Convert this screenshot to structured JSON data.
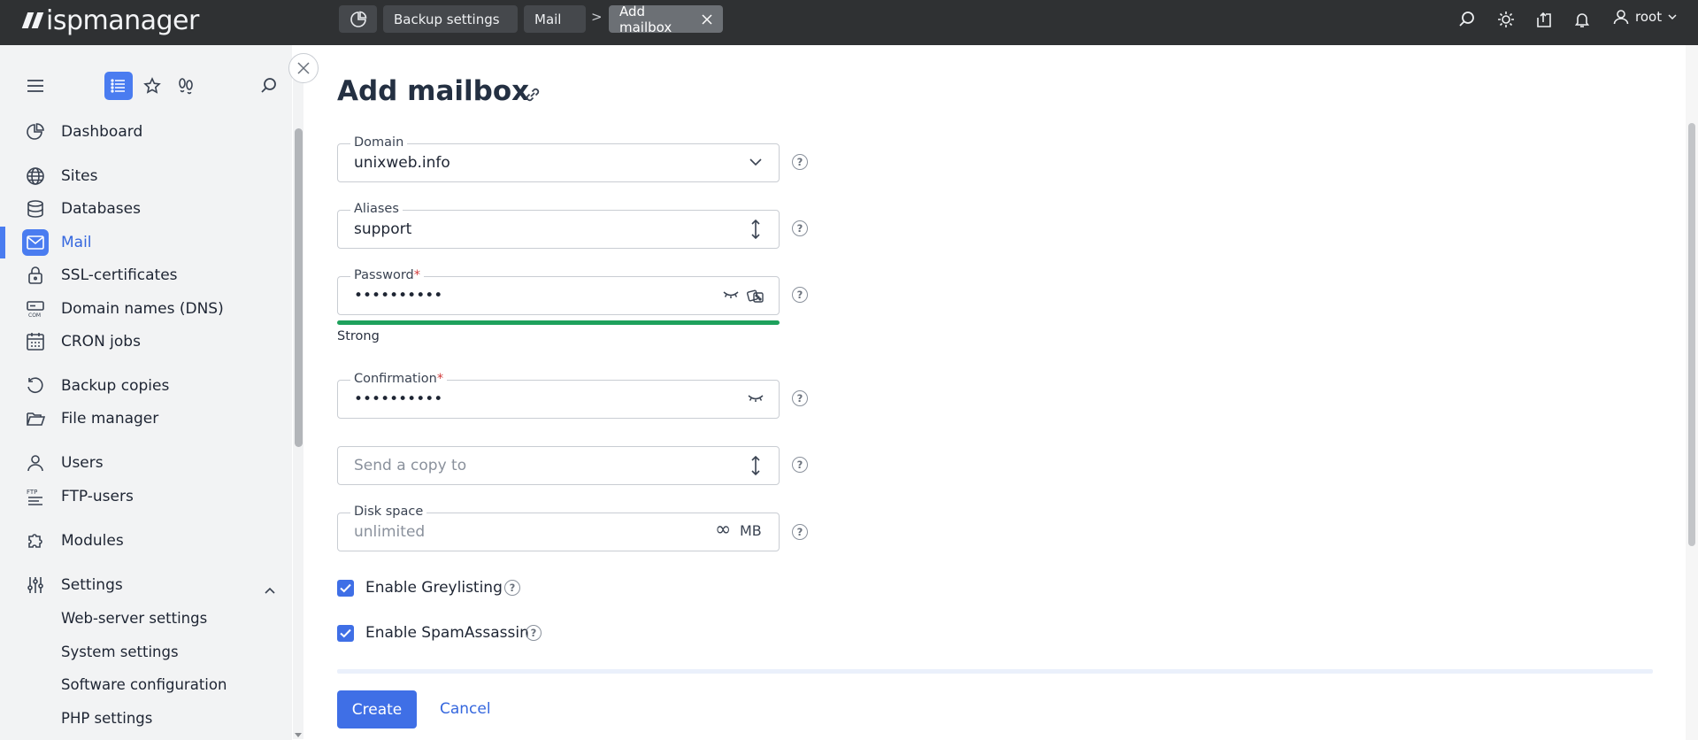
{
  "app": {
    "logo_text": "ispmanager"
  },
  "topbar": {
    "tabs": [
      {
        "label": "Backup settings"
      },
      {
        "label": "Mail"
      },
      {
        "label": "Add mailbox",
        "active": true
      }
    ],
    "breadcrumb_separator": ">",
    "icons": [
      "search-icon",
      "sun-icon",
      "upload-icon",
      "bell-icon",
      "user-icon"
    ],
    "user": {
      "name": "root"
    }
  },
  "sidebar": {
    "tools": [
      "list-view-icon",
      "star-icon",
      "footprints-icon",
      "search-icon"
    ],
    "items": [
      {
        "label": "Dashboard",
        "icon": "pie-chart-icon"
      },
      {
        "label": "Sites",
        "icon": "globe-icon"
      },
      {
        "label": "Databases",
        "icon": "database-icon"
      },
      {
        "label": "Mail",
        "icon": "mail-icon",
        "active": true
      },
      {
        "label": "SSL-certificates",
        "icon": "lock-icon"
      },
      {
        "label": "Domain names (DNS)",
        "icon": "dns-icon"
      },
      {
        "label": "CRON jobs",
        "icon": "calendar-icon"
      },
      {
        "label": "Backup copies",
        "icon": "backup-icon"
      },
      {
        "label": "File manager",
        "icon": "folder-icon"
      },
      {
        "label": "Users",
        "icon": "user-icon"
      },
      {
        "label": "FTP-users",
        "icon": "ftp-icon"
      },
      {
        "label": "Modules",
        "icon": "puzzle-icon"
      },
      {
        "label": "Settings",
        "icon": "sliders-icon",
        "expanded": true
      }
    ],
    "settings_sub": [
      {
        "label": "Web-server settings"
      },
      {
        "label": "System settings"
      },
      {
        "label": "Software configuration"
      },
      {
        "label": "PHP settings"
      }
    ]
  },
  "form": {
    "title": "Add mailbox",
    "fields": {
      "domain": {
        "label": "Domain",
        "value": "unixweb.info"
      },
      "aliases": {
        "label": "Aliases",
        "value": "support"
      },
      "password": {
        "label": "Password",
        "required_mark": "*",
        "value": "••••••••••"
      },
      "password_strength": {
        "label": "Strong",
        "level": 1.0,
        "color": "#1ea15c"
      },
      "confirmation": {
        "label": "Confirmation",
        "required_mark": "*",
        "value": "••••••••••"
      },
      "send_copy": {
        "placeholder": "Send a copy to"
      },
      "disk_space": {
        "label": "Disk space",
        "placeholder": "unlimited",
        "infinity": "∞",
        "unit": "MB"
      }
    },
    "help_glyph": "?",
    "checkboxes": [
      {
        "label": "Enable Greylisting",
        "checked": true
      },
      {
        "label": "Enable SpamAssassin",
        "checked": true
      }
    ],
    "buttons": {
      "create": "Create",
      "cancel": "Cancel"
    }
  },
  "colors": {
    "accent": "#3f6fe6",
    "topbar": "#2f3133",
    "sidebar": "#f2f3f4",
    "strength_strong": "#1ea15c"
  }
}
